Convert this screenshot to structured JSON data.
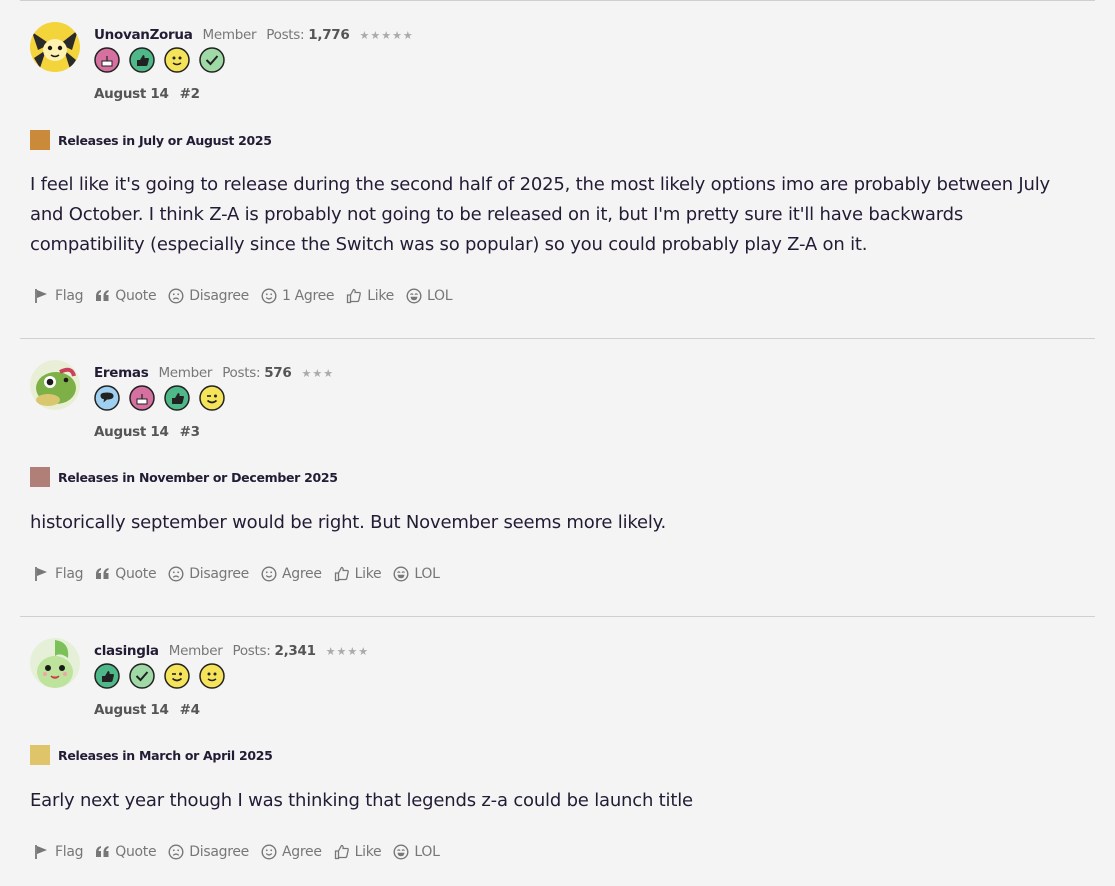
{
  "posts": [
    {
      "username": "UnovanZorua",
      "role": "Member",
      "posts_label": "Posts:",
      "posts_count": "1,776",
      "stars": "★★★★★",
      "badges": [
        "cake-badge-icon",
        "thumbs-up-badge-icon",
        "smile-badge-icon",
        "check-badge-icon"
      ],
      "date": "August 14",
      "post_number": "#2",
      "poll_vote": "Releases in July or August 2025",
      "poll_color": "#c98a3a",
      "text": "I feel like it's going to release during the second half of 2025, the most likely options imo are probably between July and October. I think Z-A is probably not going to be released on it, but I'm pretty sure it'll have backwards compatibility (especially since the Switch was so popular) so you could probably play Z-A on it.",
      "actions": {
        "flag": "Flag",
        "quote": "Quote",
        "disagree": "Disagree",
        "agree_count": "1",
        "agree": "Agree",
        "like": "Like",
        "lol": "LOL"
      }
    },
    {
      "username": "Eremas",
      "role": "Member",
      "posts_label": "Posts:",
      "posts_count": "576",
      "stars": "★★★",
      "badges": [
        "speech-bubble-badge-icon",
        "cake-badge-icon",
        "thumbs-up-badge-icon",
        "wink-badge-icon"
      ],
      "date": "August 14",
      "post_number": "#3",
      "poll_vote": "Releases in November or December 2025",
      "poll_color": "#b08078",
      "text": "historically september would be right. But November seems more likely.",
      "actions": {
        "flag": "Flag",
        "quote": "Quote",
        "disagree": "Disagree",
        "agree": "Agree",
        "like": "Like",
        "lol": "LOL"
      }
    },
    {
      "username": "clasingla",
      "role": "Member",
      "posts_label": "Posts:",
      "posts_count": "2,341",
      "stars": "★★★★",
      "badges": [
        "thumbs-up-badge-icon",
        "check-badge-icon",
        "wink-badge-icon",
        "smile-badge-icon"
      ],
      "date": "August 14",
      "post_number": "#4",
      "poll_vote": "Releases in March or April 2025",
      "poll_color": "#e0c46a",
      "text": "Early next year though I was thinking that legends z-a could be launch title",
      "actions": {
        "flag": "Flag",
        "quote": "Quote",
        "disagree": "Disagree",
        "agree": "Agree",
        "like": "Like",
        "lol": "LOL"
      }
    }
  ]
}
